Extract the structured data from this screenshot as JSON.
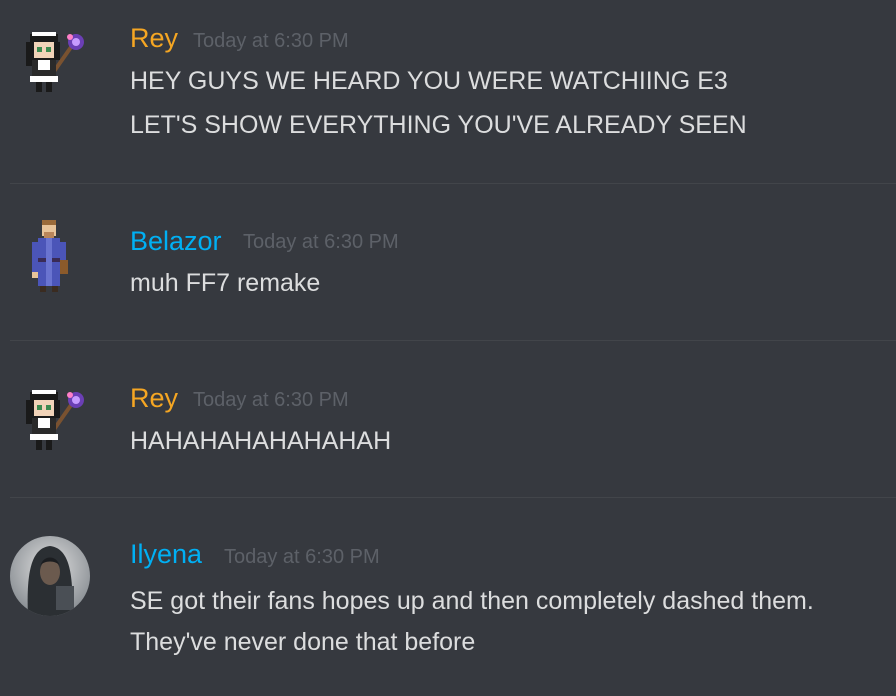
{
  "messages": [
    {
      "username": "Rey",
      "username_color": "#f5a623",
      "timestamp": "Today at 6:30 PM",
      "avatar": "pixel-maid-icon",
      "lines": [
        "HEY GUYS WE HEARD YOU WERE WATCHIING E3",
        "LET'S SHOW EVERYTHING YOU'VE ALREADY SEEN"
      ]
    },
    {
      "username": "Belazor",
      "username_color": "#00b0f4",
      "timestamp": "Today at 6:30 PM",
      "avatar": "pixel-robed-figure-icon",
      "lines": [
        "muh FF7 remake"
      ]
    },
    {
      "username": "Rey",
      "username_color": "#f5a623",
      "timestamp": "Today at 6:30 PM",
      "avatar": "pixel-maid-icon",
      "lines": [
        "HAHAHAHAHAHAHAH"
      ]
    },
    {
      "username": "Ilyena",
      "username_color": "#00b0f4",
      "timestamp": "Today at 6:30 PM",
      "avatar": "hooded-figure-photo-icon",
      "lines": [
        "SE got their fans hopes up and then completely dashed them.",
        "They've never done that before"
      ]
    }
  ]
}
